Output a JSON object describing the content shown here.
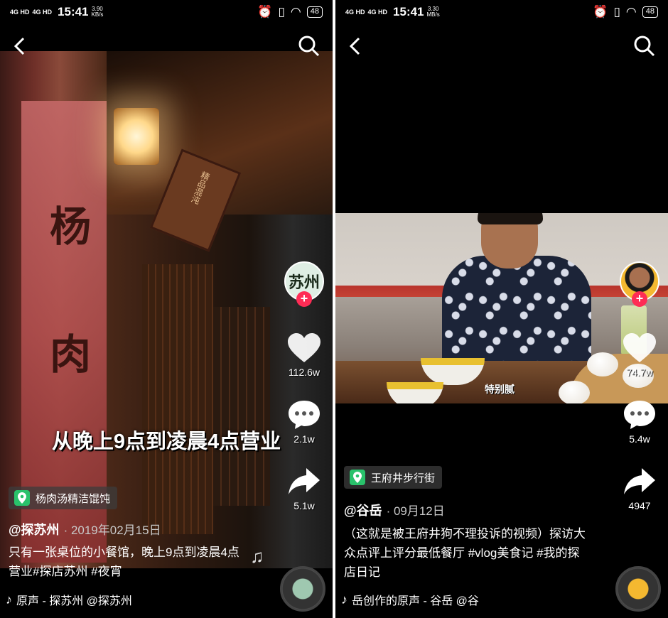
{
  "left": {
    "status": {
      "network1": "4G HD",
      "network2": "4G HD",
      "time": "15:41",
      "speed_value": "3.90",
      "speed_unit": "KB/s",
      "battery": "48"
    },
    "video_caption": "从晚上9点到凌晨4点营业",
    "sign_chars": [
      "杨",
      "肉"
    ],
    "plaque_text": "精品混沌",
    "avatar_text": "苏州",
    "actions": {
      "likes": "112.6w",
      "comments": "2.1w",
      "shares": "5.1w"
    },
    "poi": "杨肉汤精洁馄饨",
    "author": "@探苏州",
    "date": "· 2019年02月15日",
    "description": "只有一张桌位的小餐馆，晚上9点到凌晨4点营业#探店苏州 #夜宵",
    "music": "原声 - 探苏州   @探苏州"
  },
  "right": {
    "status": {
      "network1": "4G HD",
      "network2": "4G HD",
      "time": "15:41",
      "speed_value": "3.30",
      "speed_unit": "MB/s",
      "battery": "48"
    },
    "video_subtitle": "特别腻",
    "actions": {
      "likes": "74.7w",
      "comments": "5.4w",
      "shares": "4947"
    },
    "poi": "王府井步行街",
    "author": "@谷岳",
    "date": "· 09月12日",
    "description": "（这就是被王府井狗不理投诉的视频）探访大众点评上评分最低餐厅 #vlog美食记 #我的探店日记",
    "music": "岳创作的原声 - 谷岳   @谷"
  },
  "colors": {
    "follow": "#fe2c55",
    "poi_icon": "#29c26b",
    "background": "#000000"
  },
  "icons": [
    "back-icon",
    "search-icon",
    "heart-icon",
    "comment-icon",
    "share-icon",
    "location-icon",
    "music-note-icon"
  ]
}
